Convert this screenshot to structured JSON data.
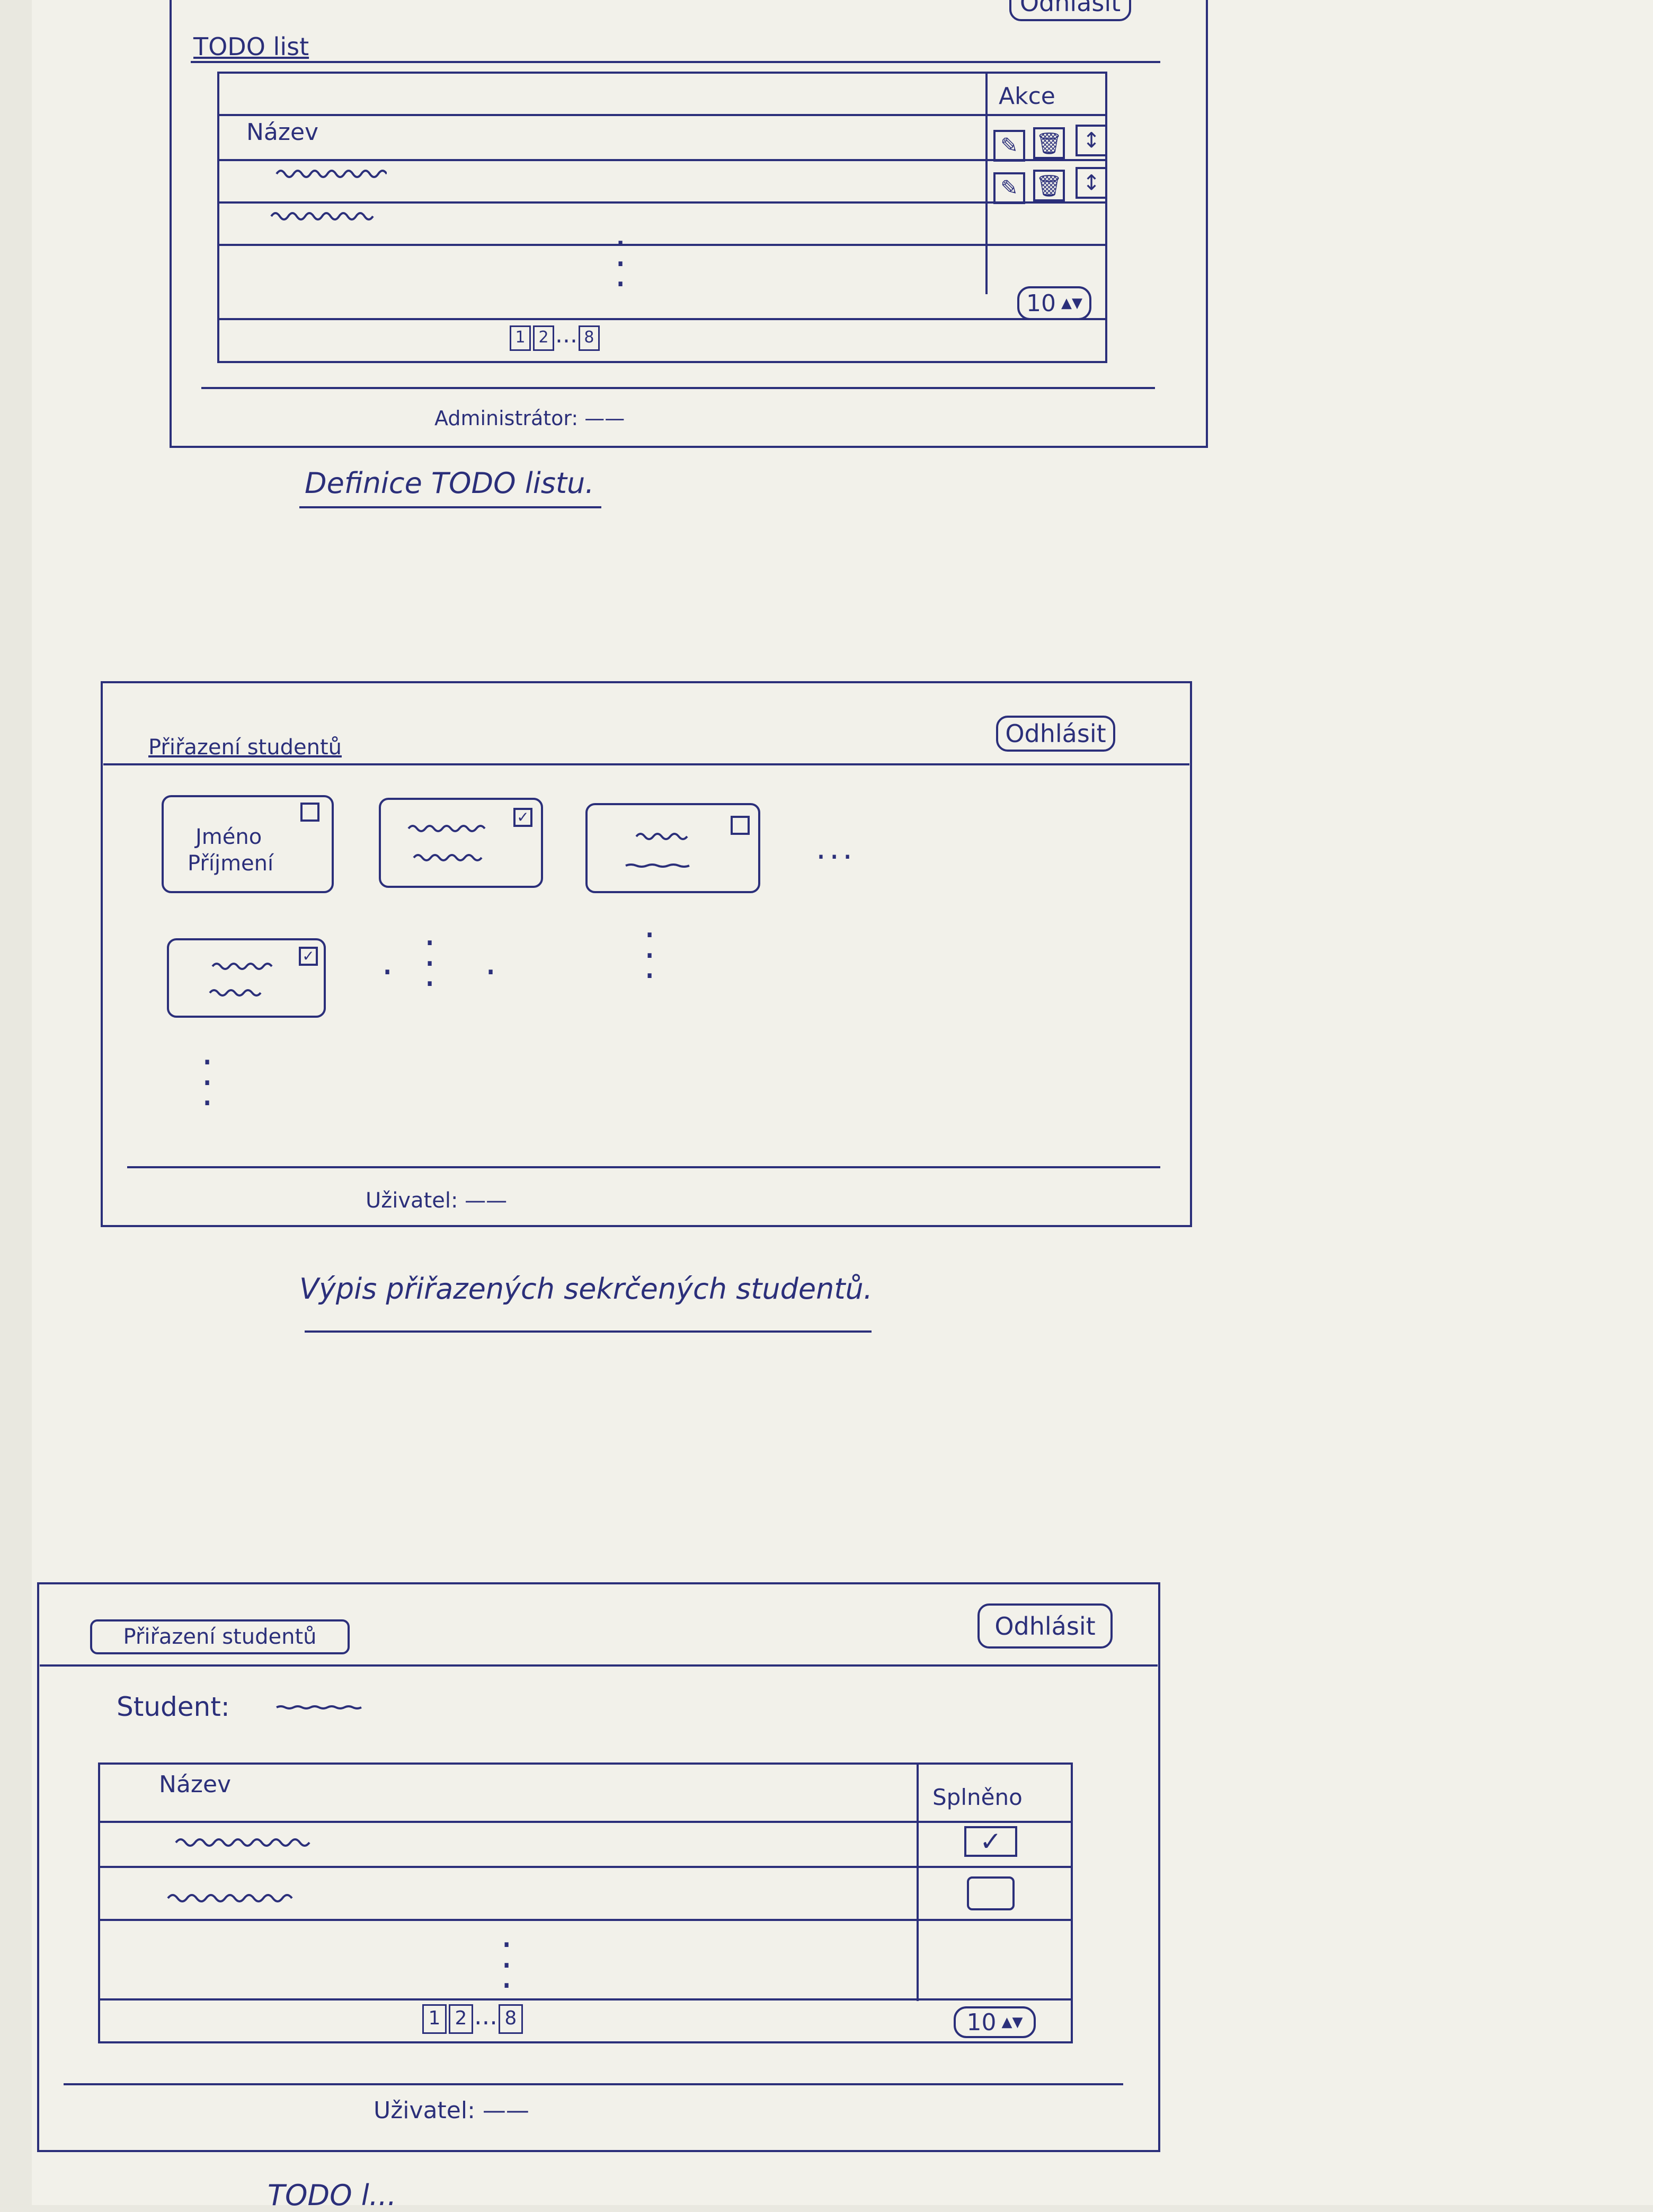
{
  "sketch1": {
    "logout_label": "Odhlásit",
    "title": "TODO list",
    "table": {
      "col_name": "Název",
      "col_actions": "Akce"
    },
    "pagination": [
      "1",
      "2",
      "...",
      "8"
    ],
    "page_size": "10",
    "footer": "Administrátor: ——",
    "caption": "Definice TODO listu."
  },
  "sketch2": {
    "title": "Přiřazení studentů",
    "logout_label": "Odhlásit",
    "card1": {
      "line1": "Jméno",
      "line2": "Příjmení"
    },
    "ellipsis": "...",
    "footer": "Uživatel: ——",
    "caption": "Výpis přiřazených sekrčených studentů."
  },
  "sketch3": {
    "title": "Přiřazení studentů",
    "logout_label": "Odhlásit",
    "student_label": "Student:",
    "table": {
      "col_name": "Název",
      "col_done": "Splněno"
    },
    "rows": [
      {
        "done": "✓"
      },
      {
        "done": ""
      }
    ],
    "pagination": [
      "1",
      "2",
      "...",
      "8"
    ],
    "page_size": "10",
    "footer": "Uživatel: ——",
    "caption": "TODO l..."
  }
}
